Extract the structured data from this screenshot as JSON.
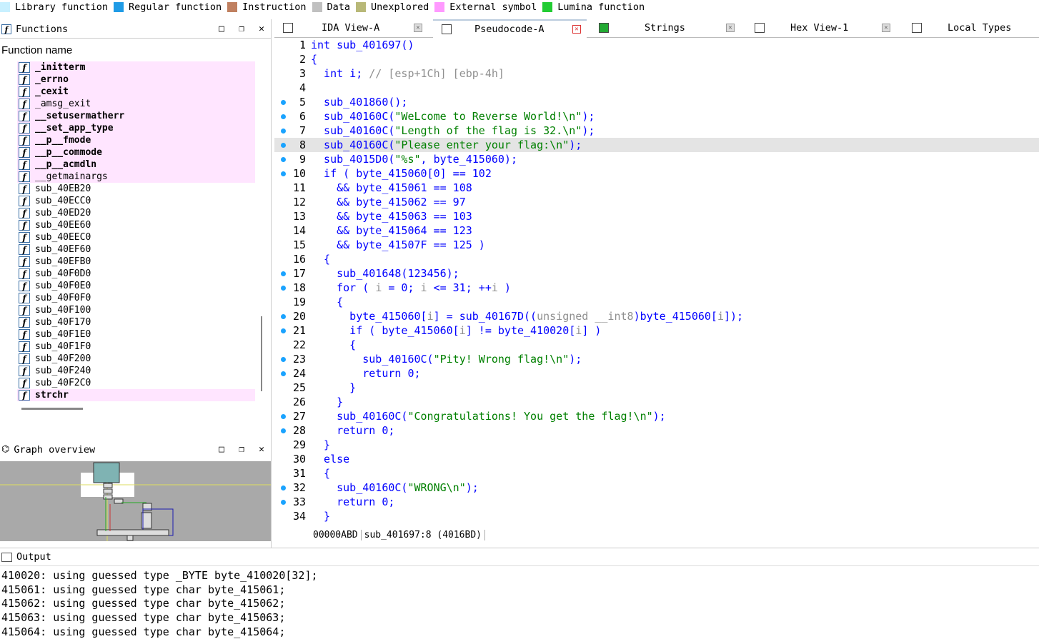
{
  "legend": [
    {
      "label": "Library function",
      "color": "#c8f0ff"
    },
    {
      "label": "Regular function",
      "color": "#1f9be6"
    },
    {
      "label": "Instruction",
      "color": "#c08060"
    },
    {
      "label": "Data",
      "color": "#c0c0c0"
    },
    {
      "label": "Unexplored",
      "color": "#b8b878"
    },
    {
      "label": "External symbol",
      "color": "#ff99ff"
    },
    {
      "label": "Lumina function",
      "color": "#22cc33"
    }
  ],
  "functions_panel": {
    "title": "Functions",
    "column_header": "Function name",
    "items": [
      {
        "name": "_initterm",
        "kind": "lib-bold"
      },
      {
        "name": "_errno",
        "kind": "lib-bold"
      },
      {
        "name": "_cexit",
        "kind": "lib-bold"
      },
      {
        "name": "_amsg_exit",
        "kind": "lib"
      },
      {
        "name": "__setusermatherr",
        "kind": "lib-bold"
      },
      {
        "name": "__set_app_type",
        "kind": "lib-bold"
      },
      {
        "name": "__p__fmode",
        "kind": "lib-bold"
      },
      {
        "name": "__p__commode",
        "kind": "lib-bold"
      },
      {
        "name": "__p__acmdln",
        "kind": "lib-bold"
      },
      {
        "name": "__getmainargs",
        "kind": "lib"
      },
      {
        "name": "sub_40EB20",
        "kind": "reg"
      },
      {
        "name": "sub_40ECC0",
        "kind": "reg"
      },
      {
        "name": "sub_40ED20",
        "kind": "reg"
      },
      {
        "name": "sub_40EE60",
        "kind": "reg"
      },
      {
        "name": "sub_40EEC0",
        "kind": "reg"
      },
      {
        "name": "sub_40EF60",
        "kind": "reg"
      },
      {
        "name": "sub_40EFB0",
        "kind": "reg"
      },
      {
        "name": "sub_40F0D0",
        "kind": "reg"
      },
      {
        "name": "sub_40F0E0",
        "kind": "reg"
      },
      {
        "name": "sub_40F0F0",
        "kind": "reg"
      },
      {
        "name": "sub_40F100",
        "kind": "reg"
      },
      {
        "name": "sub_40F170",
        "kind": "reg"
      },
      {
        "name": "sub_40F1E0",
        "kind": "reg"
      },
      {
        "name": "sub_40F1F0",
        "kind": "reg"
      },
      {
        "name": "sub_40F200",
        "kind": "reg"
      },
      {
        "name": "sub_40F240",
        "kind": "reg"
      },
      {
        "name": "sub_40F2C0",
        "kind": "reg"
      },
      {
        "name": "strchr",
        "kind": "lib-bold"
      }
    ]
  },
  "tabs": [
    {
      "label": "IDA View-A",
      "icon": "ida-view-icon",
      "active": false
    },
    {
      "label": "Pseudocode-A",
      "icon": "pseudocode-icon",
      "active": true
    },
    {
      "label": "Strings",
      "icon": "strings-icon",
      "active": false
    },
    {
      "label": "Hex View-1",
      "icon": "hex-view-icon",
      "active": false
    },
    {
      "label": "Local Types",
      "icon": "local-types-icon",
      "active": false
    }
  ],
  "code": {
    "lines": [
      {
        "n": "1",
        "dot": false,
        "t": "int sub_401697()"
      },
      {
        "n": "2",
        "dot": false,
        "t": "{"
      },
      {
        "n": "3",
        "dot": false,
        "t": "  int i; // [esp+1Ch] [ebp-4h]"
      },
      {
        "n": "4",
        "dot": false,
        "t": ""
      },
      {
        "n": "5",
        "dot": true,
        "t": "  sub_401860();"
      },
      {
        "n": "6",
        "dot": true,
        "t": "  sub_40160C(\"WeLcome to Reverse World!\\n\");"
      },
      {
        "n": "7",
        "dot": true,
        "t": "  sub_40160C(\"Length of the flag is 32.\\n\");"
      },
      {
        "n": "8",
        "dot": true,
        "t": "  sub_40160C(\"Please enter your flag:\\n\");",
        "hl": true
      },
      {
        "n": "9",
        "dot": true,
        "t": "  sub_4015D0(\"%s\", byte_415060);"
      },
      {
        "n": "10",
        "dot": true,
        "t": "  if ( byte_415060[0] == 102"
      },
      {
        "n": "11",
        "dot": false,
        "t": "    && byte_415061 == 108"
      },
      {
        "n": "12",
        "dot": false,
        "t": "    && byte_415062 == 97"
      },
      {
        "n": "13",
        "dot": false,
        "t": "    && byte_415063 == 103"
      },
      {
        "n": "14",
        "dot": false,
        "t": "    && byte_415064 == 123"
      },
      {
        "n": "15",
        "dot": false,
        "t": "    && byte_41507F == 125 )"
      },
      {
        "n": "16",
        "dot": false,
        "t": "  {"
      },
      {
        "n": "17",
        "dot": true,
        "t": "    sub_401648(123456);"
      },
      {
        "n": "18",
        "dot": true,
        "t": "    for ( i = 0; i <= 31; ++i )"
      },
      {
        "n": "19",
        "dot": false,
        "t": "    {"
      },
      {
        "n": "20",
        "dot": true,
        "t": "      byte_415060[i] = sub_40167D((unsigned __int8)byte_415060[i]);"
      },
      {
        "n": "21",
        "dot": true,
        "t": "      if ( byte_415060[i] != byte_410020[i] )"
      },
      {
        "n": "22",
        "dot": false,
        "t": "      {"
      },
      {
        "n": "23",
        "dot": true,
        "t": "        sub_40160C(\"Pity! Wrong flag!\\n\");"
      },
      {
        "n": "24",
        "dot": true,
        "t": "        return 0;"
      },
      {
        "n": "25",
        "dot": false,
        "t": "      }"
      },
      {
        "n": "26",
        "dot": false,
        "t": "    }"
      },
      {
        "n": "27",
        "dot": true,
        "t": "    sub_40160C(\"Congratulations! You get the flag!\\n\");"
      },
      {
        "n": "28",
        "dot": true,
        "t": "    return 0;"
      },
      {
        "n": "29",
        "dot": false,
        "t": "  }"
      },
      {
        "n": "30",
        "dot": false,
        "t": "  else"
      },
      {
        "n": "31",
        "dot": false,
        "t": "  {"
      },
      {
        "n": "32",
        "dot": true,
        "t": "    sub_40160C(\"WRONG\\n\");"
      },
      {
        "n": "33",
        "dot": true,
        "t": "    return 0;"
      },
      {
        "n": "34",
        "dot": false,
        "t": "  }"
      }
    ],
    "status": {
      "address": "00000ABD",
      "location": "sub_401697:8 (4016BD)"
    }
  },
  "graph_panel": {
    "title": "Graph overview"
  },
  "output_panel": {
    "title": "Output",
    "lines": [
      "410020: using guessed type _BYTE byte_410020[32];",
      "415061: using guessed type char byte_415061;",
      "415062: using guessed type char byte_415062;",
      "415063: using guessed type char byte_415063;",
      "415064: using guessed type char byte_415064;"
    ]
  },
  "window_buttons": {
    "maximize": "□",
    "restore": "❐",
    "close": "✕"
  }
}
